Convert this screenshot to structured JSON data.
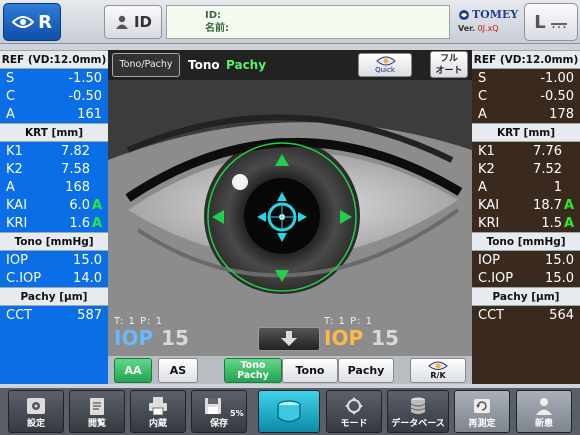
{
  "header": {
    "right_eye_label": "R",
    "id_button_label": "ID",
    "id_label": "ID:",
    "name_label": "名前:",
    "brand": "TOMEY",
    "version_prefix": "Ver.",
    "version_value": "0J.xQ",
    "left_eye_label": "L"
  },
  "left_panel": {
    "ref_header": "REF (VD:12.0mm)",
    "ref_rows": [
      {
        "k": "S",
        "v": "-1.50"
      },
      {
        "k": "C",
        "v": "-0.50"
      },
      {
        "k": "A",
        "v": "161"
      }
    ],
    "krt_header": "KRT [mm]",
    "krt_rows": [
      {
        "k": "K1",
        "v": "7.82",
        "a": ""
      },
      {
        "k": "K2",
        "v": "7.58",
        "a": ""
      },
      {
        "k": "A",
        "v": "168",
        "a": ""
      },
      {
        "k": "KAI",
        "v": "6.0",
        "a": "A"
      },
      {
        "k": "KRI",
        "v": "1.6",
        "a": "A"
      }
    ],
    "tono_header": "Tono [mmHg]",
    "tono_rows": [
      {
        "k": "IOP",
        "v": "15.0"
      },
      {
        "k": "C.IOP",
        "v": "14.0"
      }
    ],
    "pachy_header": "Pachy [μm]",
    "pachy_rows": [
      {
        "k": "CCT",
        "v": "587"
      }
    ]
  },
  "right_panel": {
    "ref_header": "REF (VD:12.0mm)",
    "ref_rows": [
      {
        "k": "S",
        "v": "-1.00"
      },
      {
        "k": "C",
        "v": "-0.50"
      },
      {
        "k": "A",
        "v": "178"
      }
    ],
    "krt_header": "KRT [mm]",
    "krt_rows": [
      {
        "k": "K1",
        "v": "7.76",
        "a": ""
      },
      {
        "k": "K2",
        "v": "7.52",
        "a": ""
      },
      {
        "k": "A",
        "v": "1",
        "a": ""
      },
      {
        "k": "KAI",
        "v": "18.7",
        "a": "A"
      },
      {
        "k": "KRI",
        "v": "1.5",
        "a": "A"
      }
    ],
    "tono_header": "Tono [mmHg]",
    "tono_rows": [
      {
        "k": "IOP",
        "v": "15.0"
      },
      {
        "k": "C.IOP",
        "v": "15.0"
      }
    ],
    "pachy_header": "Pachy [μm]",
    "pachy_rows": [
      {
        "k": "CCT",
        "v": "564"
      }
    ]
  },
  "center": {
    "tono_pachy_button": "Tono/Pachy",
    "mode_tono": "Tono",
    "mode_pachy": "Pachy",
    "quick_label": "Quick",
    "full_auto_line1": "フル",
    "full_auto_line2": "オート",
    "left_tp": "T: 1  P: 1",
    "left_iop_label": "IOP",
    "left_iop_value": "15",
    "right_tp": "T: 1  P: 1",
    "right_iop_label": "IOP",
    "right_iop_value": "15"
  },
  "bottom_buttons": {
    "aa": "AA",
    "as": "AS",
    "tono_pachy_line1": "Tono",
    "tono_pachy_line2": "Pachy",
    "tono": "Tono",
    "pachy": "Pachy",
    "rk": "R/K"
  },
  "toolbar": {
    "settings": "設定",
    "browse": "閲覧",
    "print": "内蔵",
    "save": "保存",
    "save_pct": "5%",
    "mode": "モード",
    "database": "データベース",
    "remeasure": "再測定",
    "new": "新患"
  },
  "colors": {
    "left_panel": "#0a6fe6",
    "right_panel": "#3a2a1e",
    "accent_green": "#2ee82e",
    "target_cyan": "#25d7e6"
  }
}
